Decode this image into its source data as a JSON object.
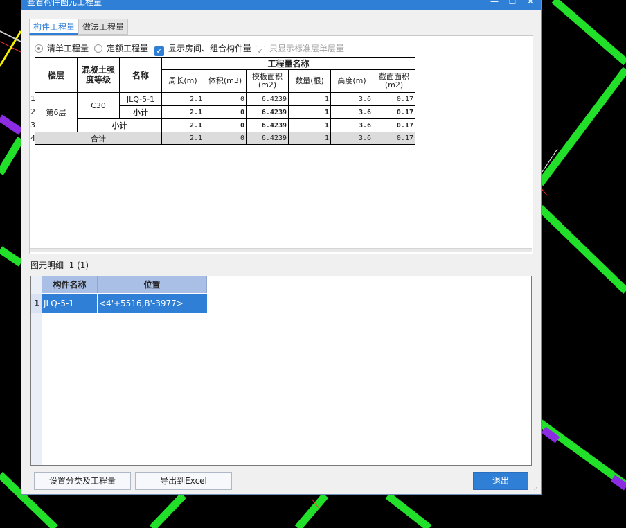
{
  "window": {
    "title": "查看构件图元工程量",
    "minimize_glyph": "—",
    "maximize_glyph": "☐",
    "close_glyph": "✕"
  },
  "tabs": [
    {
      "label": "构件工程量",
      "active": true
    },
    {
      "label": "做法工程量",
      "active": false
    }
  ],
  "options": {
    "list_quantity": "清单工程量",
    "quota_quantity": "定额工程量",
    "show_rooms": "显示房间、组合构件量",
    "standard_only": "只显示标准层单层量",
    "check_glyph": "✓"
  },
  "quantity_table": {
    "headers": {
      "floor": "楼层",
      "grade": "混凝土强度等级",
      "name": "名称",
      "group": "工程量名称",
      "perimeter": "周长(m)",
      "volume": "体积(m3)",
      "formwork": "模板面积(m2)",
      "count": "数量(根)",
      "height": "高度(m)",
      "section": "截面面积(m2)"
    },
    "row_numbers": [
      "1",
      "2",
      "3",
      "4"
    ],
    "floor": "第6层",
    "grade": "C30",
    "row1": {
      "name": "JLQ-5-1",
      "perimeter": "2.1",
      "volume": "0",
      "formwork": "6.4239",
      "count": "1",
      "height": "3.6",
      "section": "0.17"
    },
    "row2": {
      "name": "小计",
      "perimeter": "2.1",
      "volume": "0",
      "formwork": "6.4239",
      "count": "1",
      "height": "3.6",
      "section": "0.17"
    },
    "row3": {
      "name": "小计",
      "perimeter": "2.1",
      "volume": "0",
      "formwork": "6.4239",
      "count": "1",
      "height": "3.6",
      "section": "0.17"
    },
    "row4": {
      "name": "合计",
      "perimeter": "2.1",
      "volume": "0",
      "formwork": "6.4239",
      "count": "1",
      "height": "3.6",
      "section": "0.17"
    }
  },
  "detail": {
    "label": "图元明细",
    "count_text": "1 (1)",
    "headers": {
      "name": "构件名称",
      "position": "位置"
    },
    "rows": [
      {
        "num": "1",
        "name": "JLQ-5-1",
        "position": "<4'+5516,B'-3977>"
      }
    ]
  },
  "buttons": {
    "settings": "设置分类及工程量",
    "export": "导出到Excel",
    "exit": "退出"
  },
  "colors": {
    "accent": "#2f7fd6",
    "header_blue": "#a9bfe6",
    "cad_green": "#22e02a",
    "cad_purple": "#8b2be2"
  }
}
